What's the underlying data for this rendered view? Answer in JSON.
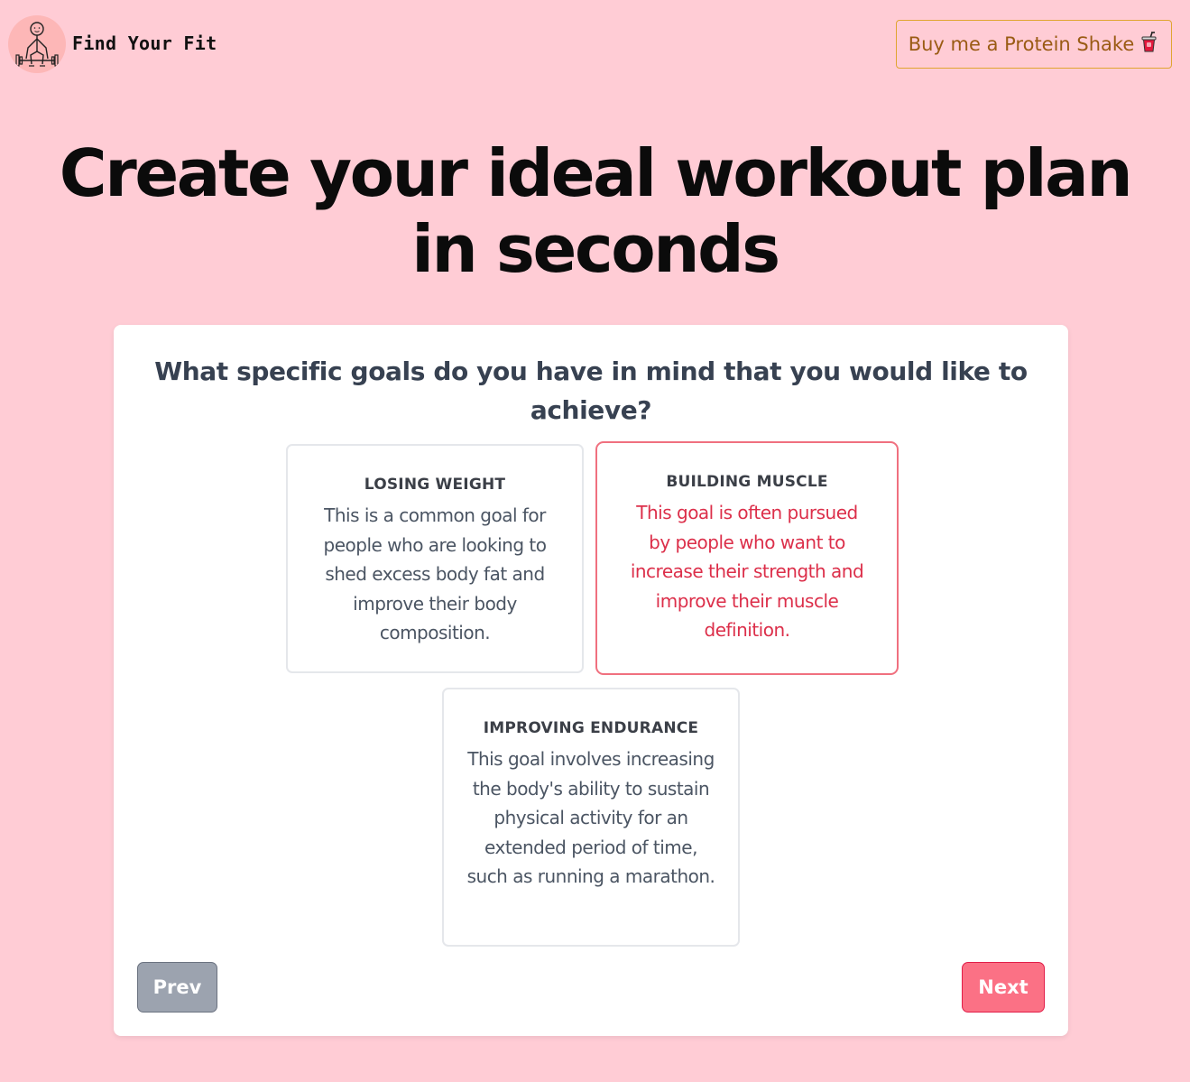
{
  "header": {
    "brand": "Find Your Fit",
    "support_button": "Buy me a Protein Shake",
    "support_icon": "protein-shake-cup-icon"
  },
  "hero": {
    "title": "Create your ideal workout plan in seconds"
  },
  "question": {
    "text": "What specific goals do you have in mind that you would like to achieve?",
    "options": [
      {
        "title": "LOSING WEIGHT",
        "description": "This is a common goal for people who are looking to shed excess body fat and improve their body composition.",
        "selected": false
      },
      {
        "title": "BUILDING MUSCLE",
        "description": "This goal is often pursued by people who want to increase their strength and improve their muscle definition.",
        "selected": true
      },
      {
        "title": "IMPROVING ENDURANCE",
        "description": "This goal involves increasing the body's ability to sustain physical activity for an extended period of time, such as running a marathon.",
        "selected": false
      }
    ]
  },
  "nav": {
    "prev": "Prev",
    "next": "Next"
  },
  "colors": {
    "background": "#ffccd5",
    "accent": "#fb7185",
    "selected_border": "#f0707f",
    "selected_text": "#dc2f4a",
    "shake_border": "#e0a530",
    "shake_text": "#9a5b14"
  }
}
